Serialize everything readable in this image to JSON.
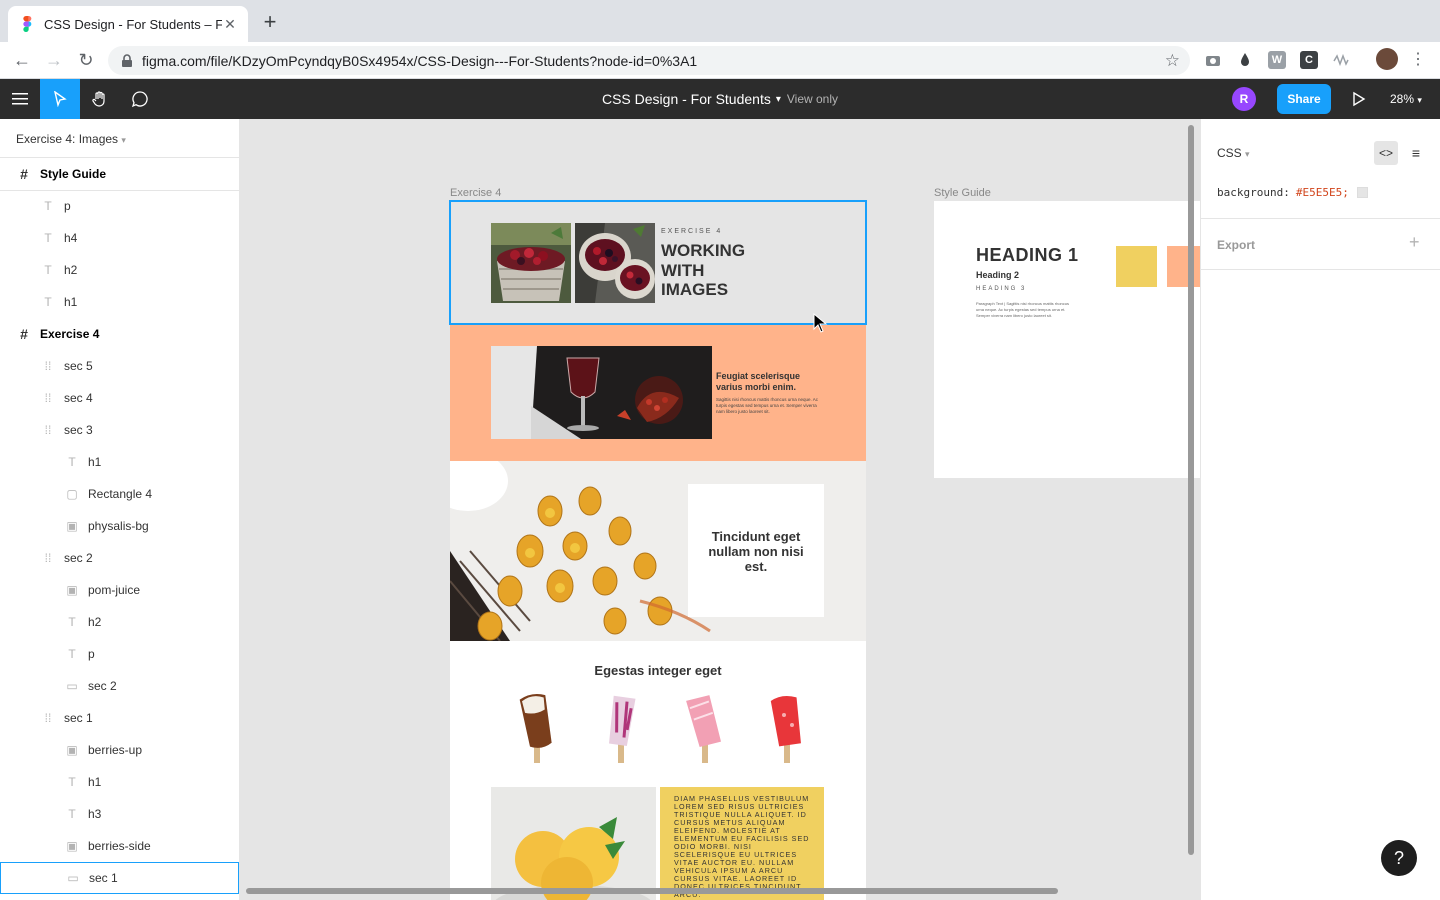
{
  "browser": {
    "tab_title": "CSS Design - For Students – Fi",
    "url": "figma.com/file/KDzyOmPcyndqyB0Sx4954x/CSS-Design---For-Students?node-id=0%3A1"
  },
  "figma": {
    "file_title": "CSS Design - For Students",
    "view_mode": "View only",
    "user_initial": "R",
    "share_label": "Share",
    "zoom": "28%"
  },
  "layers": {
    "page": "Exercise 4: Images",
    "items": [
      {
        "label": "Style Guide",
        "type": "frame",
        "indent": 0
      },
      {
        "label": "p",
        "type": "text",
        "indent": 1
      },
      {
        "label": "h4",
        "type": "text",
        "indent": 1
      },
      {
        "label": "h2",
        "type": "text",
        "indent": 1
      },
      {
        "label": "h1",
        "type": "text",
        "indent": 1
      },
      {
        "label": "Exercise 4",
        "type": "frame",
        "indent": 0
      },
      {
        "label": "sec 5",
        "type": "group",
        "indent": 1
      },
      {
        "label": "sec 4",
        "type": "group",
        "indent": 1
      },
      {
        "label": "sec 3",
        "type": "group",
        "indent": 1
      },
      {
        "label": "h1",
        "type": "text",
        "indent": 2
      },
      {
        "label": "Rectangle 4",
        "type": "rect",
        "indent": 2
      },
      {
        "label": "physalis-bg",
        "type": "image",
        "indent": 2
      },
      {
        "label": "sec 2",
        "type": "group",
        "indent": 1
      },
      {
        "label": "pom-juice",
        "type": "image",
        "indent": 2
      },
      {
        "label": "h2",
        "type": "text",
        "indent": 2
      },
      {
        "label": "p",
        "type": "text",
        "indent": 2
      },
      {
        "label": "sec 2",
        "type": "line",
        "indent": 2
      },
      {
        "label": "sec 1",
        "type": "group",
        "indent": 1
      },
      {
        "label": "berries-up",
        "type": "image",
        "indent": 2
      },
      {
        "label": "h1",
        "type": "text",
        "indent": 2
      },
      {
        "label": "h3",
        "type": "text",
        "indent": 2
      },
      {
        "label": "berries-side",
        "type": "image",
        "indent": 2
      },
      {
        "label": "sec 1",
        "type": "line",
        "indent": 2,
        "selected": true
      }
    ]
  },
  "canvas": {
    "exercise_label": "Exercise 4",
    "styleguide_label": "Style Guide",
    "sec1": {
      "kicker": "EXERCISE 4",
      "title_lines": [
        "WORKING",
        "WITH",
        "IMAGES"
      ]
    },
    "sec2": {
      "heading": "Feugiat scelerisque varius morbi enim.",
      "body": "Sagittis nisi rhoncus mattis rhoncus urna neque. Ac turpis egestas sed tempus urna et. Semper viverra nam libero justo laoreet sit."
    },
    "sec3": {
      "heading": "Tincidunt eget nullam non nisi est."
    },
    "sec4": {
      "heading": "Egestas integer eget"
    },
    "sec5": {
      "caps_text": "DIAM PHASELLUS VESTIBULUM LOREM SED RISUS ULTRICIES TRISTIQUE NULLA ALIQUET. ID CURSUS METUS ALIQUAM ELEIFEND. MOLESTIE AT ELEMENTUM EU FACILISIS SED ODIO MORBI. NISI SCELERISQUE EU ULTRICES VITAE AUCTOR EU. NULLAM VEHICULA IPSUM A ARCU CURSUS VITAE. LAOREET ID DONEC ULTRICES TINCIDUNT ARCU."
    },
    "styleguide": {
      "h1": "HEADING 1",
      "h2": "Heading 2",
      "h3": "HEADING 3",
      "p": "Paragraph Text | Sagittis nisi rhoncus mattis rhoncus urna neque. Ac turpis egestas sed tempus urna et. Semper viverra nam libero justo laoreet sit.",
      "swatches": [
        "#f0d060",
        "#ffb38a"
      ]
    }
  },
  "inspector": {
    "lang": "CSS",
    "property": "background:",
    "value": "#E5E5E5;",
    "value_color": "#E5E5E5",
    "export_label": "Export",
    "help": "?"
  },
  "colors": {
    "accent": "#18a0fb",
    "peach": "#ffb38a",
    "yellow": "#f0d060"
  }
}
